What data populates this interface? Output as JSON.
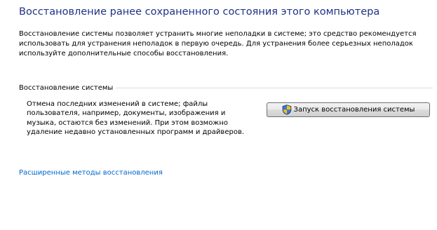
{
  "page": {
    "title": "Восстановление ранее сохраненного состояния этого компьютера",
    "intro": "Восстановление системы позволяет устранить многие неполадки в системе; это средство рекомендуется использовать для устранения неполадок в первую очередь. Для устранения более серьезных неполадок используйте дополнительные способы восстановления."
  },
  "system_restore": {
    "section_title": "Восстановление системы",
    "description": "Отмена последних изменений в системе; файлы пользователя, например, документы, изображения и музыка, остаются без изменений. При этом возможно удаление недавно установленных программ и драйверов.",
    "button_label": "Запуск восстановления системы",
    "button_icon": "uac-shield-icon"
  },
  "links": {
    "advanced_methods": "Расширенные методы восстановления"
  },
  "colors": {
    "title": "#1e3287",
    "link": "#0066cc",
    "section_rule": "#d5dfe5"
  }
}
